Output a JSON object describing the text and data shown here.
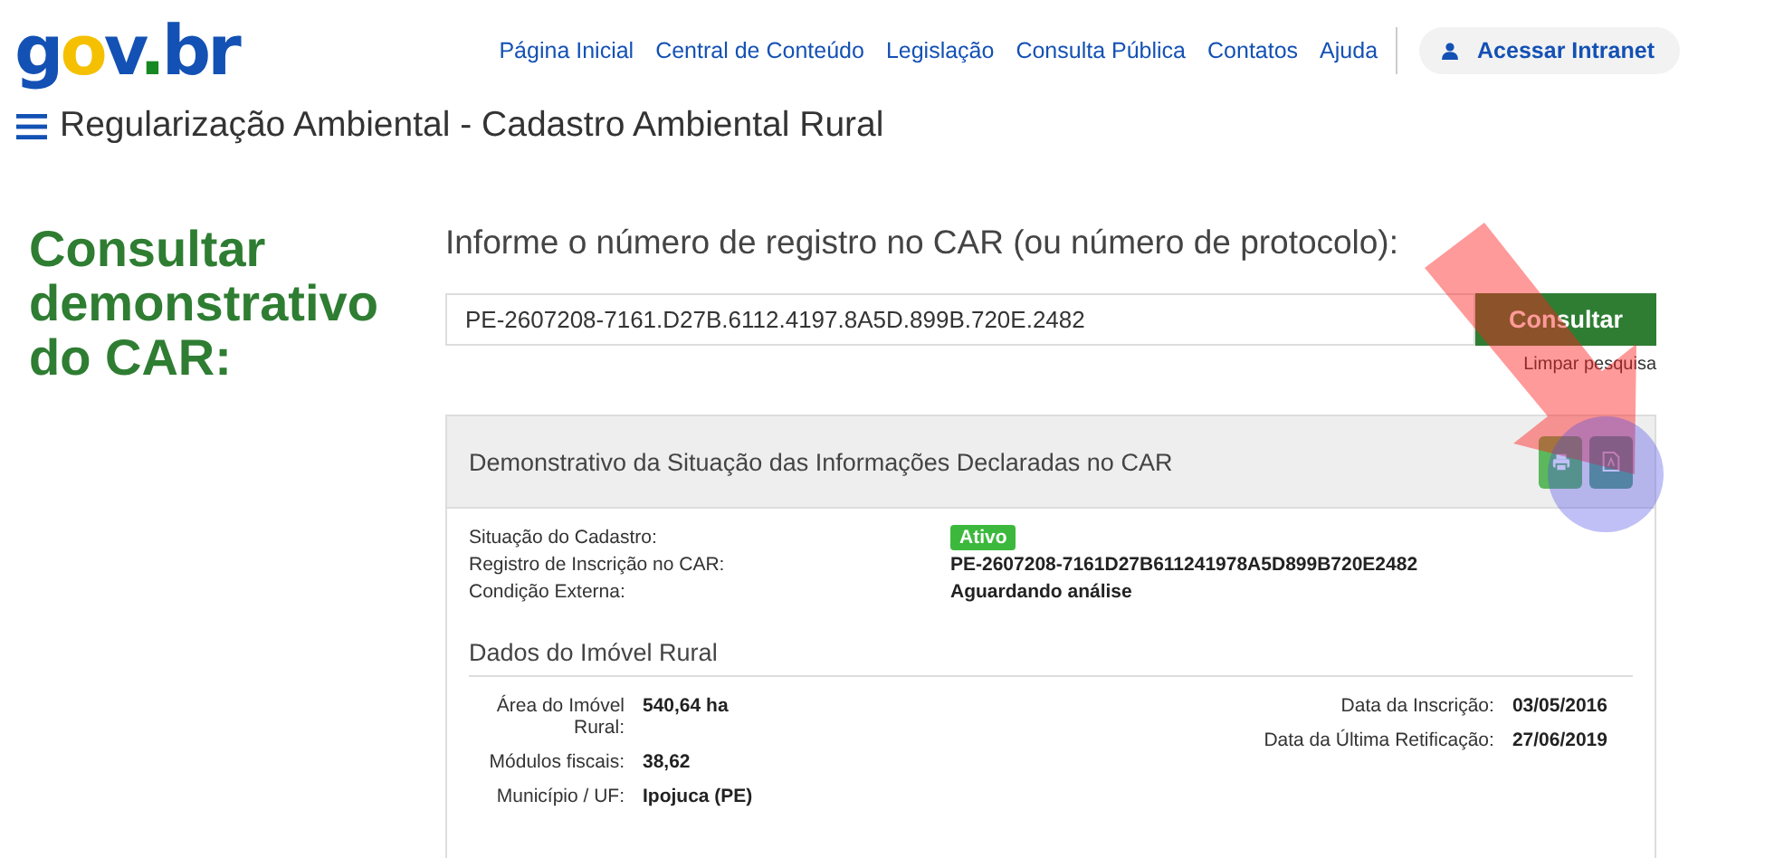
{
  "header": {
    "logo": "gov.br",
    "nav": [
      {
        "label": "Página Inicial"
      },
      {
        "label": "Central de Conteúdo"
      },
      {
        "label": "Legislação"
      },
      {
        "label": "Consulta Pública"
      },
      {
        "label": "Contatos"
      },
      {
        "label": "Ajuda"
      }
    ],
    "login_button": "Acessar Intranet"
  },
  "page_title": "Regularização Ambiental - Cadastro Ambiental Rural",
  "heading": "Consultar demonstrativo do CAR:",
  "search": {
    "label": "Informe o número de registro no CAR (ou número de protocolo):",
    "value": "PE-2607208-7161.D27B.6112.4197.8A5D.899B.720E.2482",
    "button": "Consultar",
    "clear_link": "Limpar pesquisa"
  },
  "card": {
    "title": "Demonstrativo da Situação das Informações Declaradas no CAR",
    "fields": [
      {
        "label": "Situação do Cadastro:",
        "value": "Ativo",
        "kind": "badge"
      },
      {
        "label": "Registro de Inscrição no CAR:",
        "value": "PE-2607208-7161D27B611241978A5D899B720E2482",
        "kind": "text"
      },
      {
        "label": "Condição Externa:",
        "value": "Aguardando análise",
        "kind": "text"
      }
    ],
    "section_title": "Dados do Imóvel Rural",
    "left_details": [
      {
        "label": "Área do Imóvel Rural:",
        "value": "540,64 ha"
      },
      {
        "label": "Módulos fiscais:",
        "value": "38,62"
      },
      {
        "label": "Município / UF:",
        "value": "Ipojuca (PE)"
      }
    ],
    "right_details": [
      {
        "label": "Data da Inscrição:",
        "value": "03/05/2016"
      },
      {
        "label": "Data da Última Retificação:",
        "value": "27/06/2019"
      }
    ]
  }
}
